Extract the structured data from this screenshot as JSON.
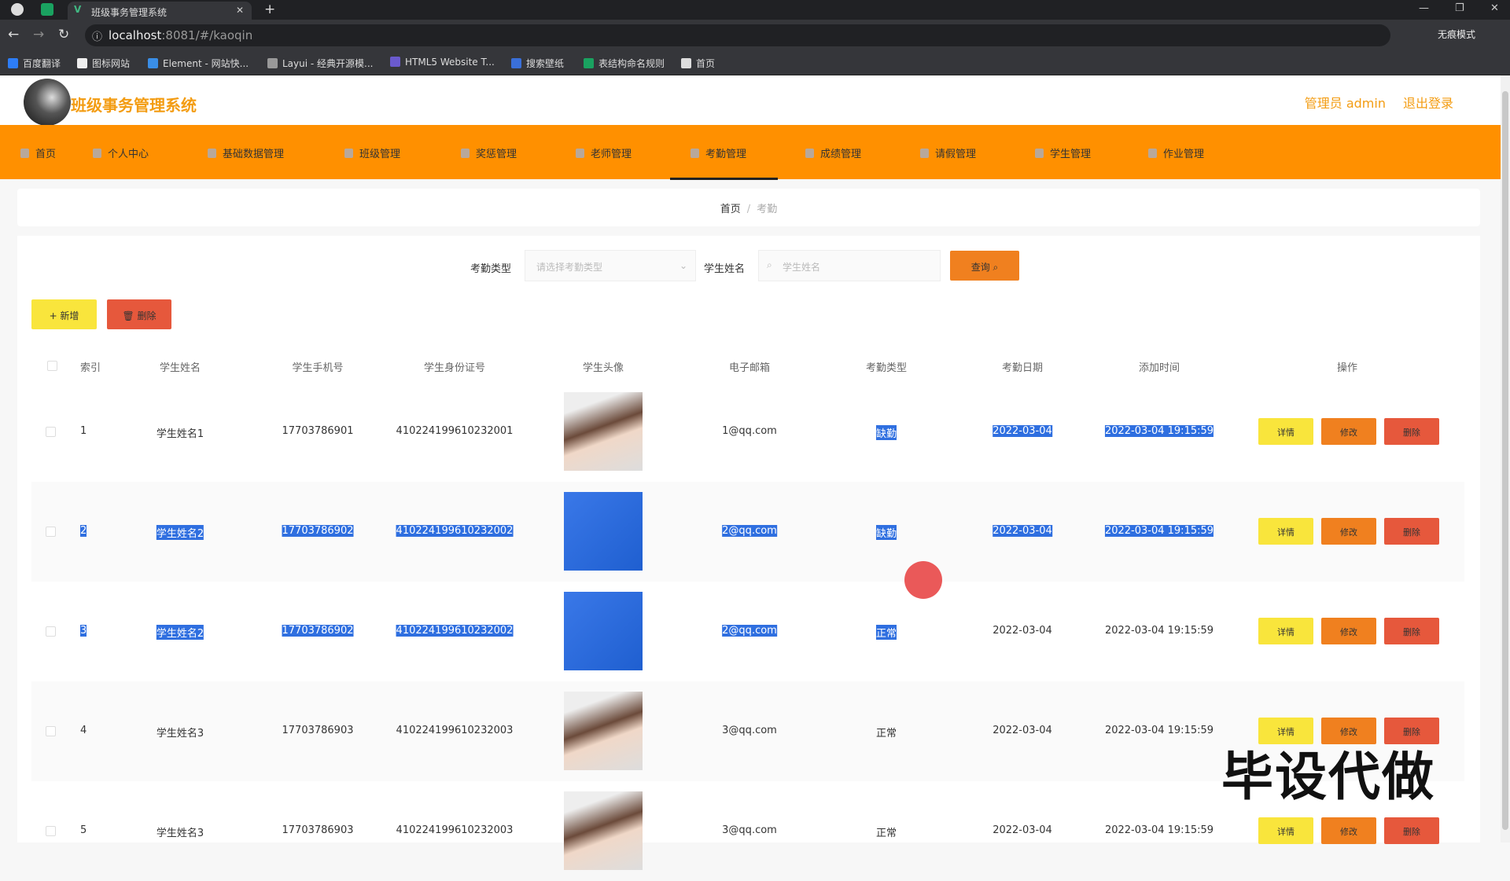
{
  "browser": {
    "tab_title": "班级事务管理系统",
    "url_host": "localhost",
    "url_rest": ":8081/#/kaoqin",
    "incognito": "无痕模式",
    "bookmarks": [
      "百度翻译",
      "图标网站",
      "Element - 网站快...",
      "Layui - 经典开源模...",
      "HTML5 Website T...",
      "搜索壁纸",
      "表结构命名规则",
      "首页"
    ]
  },
  "header": {
    "title": "班级事务管理系统",
    "user": "管理员 admin",
    "logout": "退出登录",
    "accent": "#ff9000"
  },
  "menu": [
    "首页",
    "个人中心",
    "基础数据管理",
    "班级管理",
    "奖惩管理",
    "老师管理",
    "考勤管理",
    "成绩管理",
    "请假管理",
    "学生管理",
    "作业管理"
  ],
  "breadcrumb": {
    "home": "首页",
    "current": "考勤"
  },
  "search": {
    "type_label": "考勤类型",
    "type_placeholder": "请选择考勤类型",
    "name_label": "学生姓名",
    "name_placeholder": "学生姓名",
    "query": "查询"
  },
  "actions": {
    "add": "+ 新增",
    "delete": "删除"
  },
  "table": {
    "headers": [
      "索引",
      "学生姓名",
      "学生手机号",
      "学生身份证号",
      "学生头像",
      "电子邮箱",
      "考勤类型",
      "考勤日期",
      "添加时间",
      "操作"
    ],
    "ops": {
      "detail": "详情",
      "edit": "修改",
      "delete": "删除"
    },
    "rows": [
      {
        "index": "1",
        "name": "学生姓名1",
        "phone": "17703786901",
        "id_card": "410224199610232001",
        "email": "1@qq.com",
        "type": "缺勤",
        "date": "2022-03-04",
        "time": "2022-03-04 19:15:59",
        "highlight": [
          6,
          7,
          8
        ]
      },
      {
        "index": "2",
        "name": "学生姓名2",
        "phone": "17703786902",
        "id_card": "410224199610232002",
        "email": "2@qq.com",
        "type": "缺勤",
        "date": "2022-03-04",
        "time": "2022-03-04 19:15:59",
        "highlight": [
          0,
          1,
          2,
          3,
          4,
          5,
          6,
          7,
          8
        ]
      },
      {
        "index": "3",
        "name": "学生姓名2",
        "phone": "17703786902",
        "id_card": "410224199610232002",
        "email": "2@qq.com",
        "type": "正常",
        "date": "2022-03-04",
        "time": "2022-03-04 19:15:59",
        "highlight": [
          0,
          1,
          2,
          3,
          4,
          5,
          6
        ]
      },
      {
        "index": "4",
        "name": "学生姓名3",
        "phone": "17703786903",
        "id_card": "410224199610232003",
        "email": "3@qq.com",
        "type": "正常",
        "date": "2022-03-04",
        "time": "2022-03-04 19:15:59",
        "highlight": []
      },
      {
        "index": "5",
        "name": "学生姓名3",
        "phone": "17703786903",
        "id_card": "410224199610232003",
        "email": "3@qq.com",
        "type": "正常",
        "date": "2022-03-04",
        "time": "2022-03-04 19:15:59",
        "highlight": []
      }
    ]
  },
  "watermark": "毕设代做"
}
